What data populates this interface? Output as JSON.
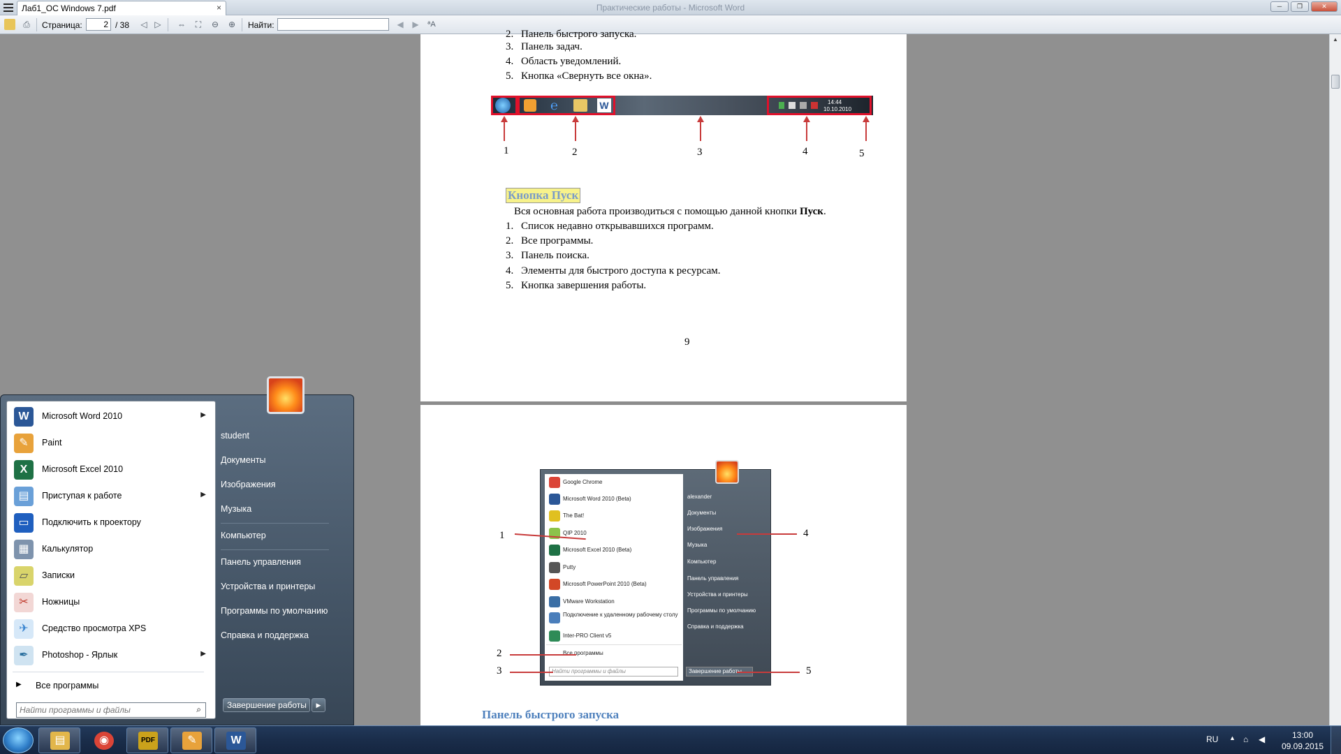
{
  "window": {
    "tab_title": "Лаб1_ОС Windows 7.pdf",
    "title": "Практические работы - Microsoft Word",
    "tab_close": "×"
  },
  "toolbar": {
    "page_label": "Страница:",
    "page_value": "2",
    "page_total": "/ 38",
    "find_label": "Найти:",
    "find_value": ""
  },
  "page1": {
    "list_top": [
      {
        "n": "2.",
        "text": "Панель быстрого запуска."
      },
      {
        "n": "3.",
        "text": "Панель задач."
      },
      {
        "n": "4.",
        "text": "Область уведомлений."
      },
      {
        "n": "5.",
        "text": "Кнопка «Свернуть все окна»."
      }
    ],
    "figure": {
      "clock_time": "14:44",
      "clock_date": "10.10.2010",
      "labels": [
        "1",
        "2",
        "3",
        "4",
        "5"
      ]
    },
    "heading": "Кнопка Пуск",
    "intro_before": "Вся основная работа производиться с помощью данной кнопки ",
    "intro_bold": "Пуск",
    "intro_after": ".",
    "list": [
      {
        "n": "1.",
        "text": "Список недавно открывавшихся программ."
      },
      {
        "n": "2.",
        "text": "Все программы."
      },
      {
        "n": "3.",
        "text": "Панель поиска."
      },
      {
        "n": "4.",
        "text": "Элементы для быстрого доступа к ресурсам."
      },
      {
        "n": "5.",
        "text": "Кнопка завершения работы."
      }
    ],
    "page_number": "9"
  },
  "page2": {
    "figure": {
      "left_items": [
        "Google Chrome",
        "Microsoft Word 2010 (Beta)",
        "The Bat!",
        "QIP 2010",
        "Microsoft Excel 2010 (Beta)",
        "Putty",
        "Microsoft PowerPoint 2010 (Beta)",
        "VMware Workstation",
        "Подключение к удаленному рабочему столу",
        "Inter-PRO Client v5"
      ],
      "all_programs": "Все программы",
      "search_placeholder": "Найти программы и файлы",
      "right_items": [
        "alexander",
        "Документы",
        "Изображения",
        "Музыка",
        "Компьютер",
        "Панель управления",
        "Устройства и принтеры",
        "Программы по умолчанию",
        "Справка и поддержка"
      ],
      "shutdown": "Завершение работы",
      "labels": [
        "1",
        "2",
        "3",
        "4",
        "5"
      ]
    },
    "heading": "Панель быстрого запуска"
  },
  "start_menu": {
    "items": [
      {
        "label": "Microsoft Word 2010",
        "color": "#2b5797",
        "glyph": "W",
        "submenu": true
      },
      {
        "label": "Paint",
        "color": "#e8a23b",
        "glyph": "✎",
        "submenu": false
      },
      {
        "label": "Microsoft Excel 2010",
        "color": "#1e7145",
        "glyph": "X",
        "submenu": false
      },
      {
        "label": "Приступая к работе",
        "color": "#6aa0d8",
        "glyph": "▤",
        "submenu": true
      },
      {
        "label": "Подключить к проектору",
        "color": "#1f5fbf",
        "glyph": "▭",
        "submenu": false
      },
      {
        "label": "Калькулятор",
        "color": "#7e93ad",
        "glyph": "▦",
        "submenu": false
      },
      {
        "label": "Записки",
        "color": "#d9d46b",
        "glyph": "▱",
        "submenu": false
      },
      {
        "label": "Ножницы",
        "color": "#c0392b",
        "glyph": "✂",
        "submenu": false
      },
      {
        "label": "Средство просмотра XPS",
        "color": "#3a85d0",
        "glyph": "✈",
        "submenu": false
      },
      {
        "label": "Photoshop - Ярлык",
        "color": "#2a6f9e",
        "glyph": "✒",
        "submenu": true
      }
    ],
    "submenu_arrow": "▶",
    "all_programs": "Все программы",
    "search_placeholder": "Найти программы и файлы",
    "right": {
      "user": "student",
      "documents": "Документы",
      "pictures": "Изображения",
      "music": "Музыка",
      "computer": "Компьютер",
      "control_panel": "Панель управления",
      "devices": "Устройства и принтеры",
      "default_programs": "Программы по умолчанию",
      "help": "Справка и поддержка"
    },
    "shutdown": "Завершение работы"
  },
  "taskbar": {
    "apps": [
      {
        "name": "explorer",
        "color": "#e2b64a",
        "glyph": "▤"
      },
      {
        "name": "chrome",
        "color": "#db4437",
        "glyph": "◉"
      },
      {
        "name": "pdf-reader",
        "color": "#caa21b",
        "glyph": "PDF"
      },
      {
        "name": "paint",
        "color": "#e8a23b",
        "glyph": "✎"
      },
      {
        "name": "word",
        "color": "#2b5797",
        "glyph": "W"
      }
    ],
    "lang": "RU",
    "time": "13:00",
    "date": "09.09.2015"
  }
}
